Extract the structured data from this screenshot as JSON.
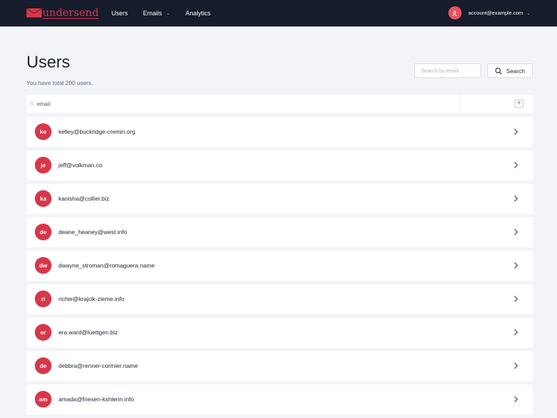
{
  "brand": {
    "name": "undersend",
    "color": "#d7374a"
  },
  "nav": {
    "items": [
      {
        "label": "Users"
      },
      {
        "label": "Emails",
        "has_dropdown": true
      },
      {
        "label": "Analytics"
      }
    ]
  },
  "account": {
    "email": "account@example.com",
    "icon": "user-icon"
  },
  "page": {
    "title": "Users",
    "subtitle": "You have total 200 users."
  },
  "search": {
    "placeholder": "Search by email",
    "value": "",
    "button_label": "Search"
  },
  "table": {
    "column": "email",
    "add_column_label": "+"
  },
  "users": [
    {
      "initials": "ke",
      "email": "kelley@buckridge-cremin.org"
    },
    {
      "initials": "je",
      "email": "jeff@volkman.co"
    },
    {
      "initials": "ka",
      "email": "kanisha@collier.biz"
    },
    {
      "initials": "de",
      "email": "deane_heaney@west.info"
    },
    {
      "initials": "dw",
      "email": "dwayne_stroman@romaguera.name"
    },
    {
      "initials": "ri",
      "email": "richie@krajcik-zieme.info"
    },
    {
      "initials": "er",
      "email": "era.ward@luettgen.biz"
    },
    {
      "initials": "de",
      "email": "debbra@renner-cormier.name"
    },
    {
      "initials": "am",
      "email": "amada@friesen-kshlerin.info"
    }
  ]
}
